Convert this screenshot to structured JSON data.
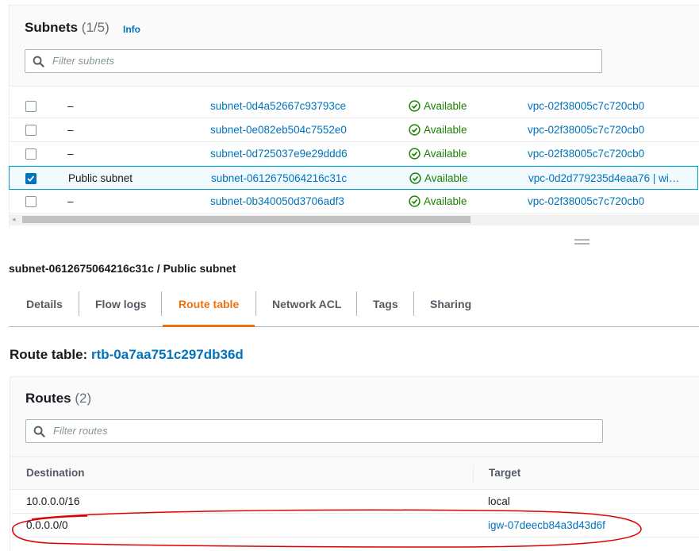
{
  "subnets_panel": {
    "title": "Subnets",
    "count": "(1/5)",
    "info_link": "Info",
    "filter_placeholder": "Filter subnets",
    "rows": [
      {
        "name": "–",
        "subnet_id": "subnet-0d4a52667c93793ce",
        "state": "Available",
        "vpc": "vpc-02f38005c7c720cb0",
        "checked": false
      },
      {
        "name": "–",
        "subnet_id": "subnet-0e082eb504c7552e0",
        "state": "Available",
        "vpc": "vpc-02f38005c7c720cb0",
        "checked": false
      },
      {
        "name": "–",
        "subnet_id": "subnet-0d725037e9e29ddd6",
        "state": "Available",
        "vpc": "vpc-02f38005c7c720cb0",
        "checked": false
      },
      {
        "name": "Public subnet",
        "subnet_id": "subnet-0612675064216c31c",
        "state": "Available",
        "vpc": "vpc-0d2d779235d4eaa76 | wi…",
        "checked": true
      },
      {
        "name": "–",
        "subnet_id": "subnet-0b340050d3706adf3",
        "state": "Available",
        "vpc": "vpc-02f38005c7c720cb0",
        "checked": false
      }
    ]
  },
  "detail": {
    "title": "subnet-0612675064216c31c / Public subnet",
    "tabs": [
      "Details",
      "Flow logs",
      "Route table",
      "Network ACL",
      "Tags",
      "Sharing"
    ],
    "active_tab": "Route table"
  },
  "route_table": {
    "label": "Route table:",
    "id": "rtb-0a7aa751c297db36d"
  },
  "routes_panel": {
    "title": "Routes",
    "count": "(2)",
    "filter_placeholder": "Filter routes",
    "columns": [
      "Destination",
      "Target"
    ],
    "rows": [
      {
        "destination": "10.0.0.0/16",
        "target": "local",
        "target_is_link": false
      },
      {
        "destination": "0.0.0.0/0",
        "target": "igw-07deecb84a3d43d6f",
        "target_is_link": true
      }
    ]
  },
  "colors": {
    "link": "#0073bb",
    "available": "#1d8102",
    "active_tab": "#ec7211",
    "selected_row_border": "#00a1c9",
    "annotation": "#e00000"
  }
}
